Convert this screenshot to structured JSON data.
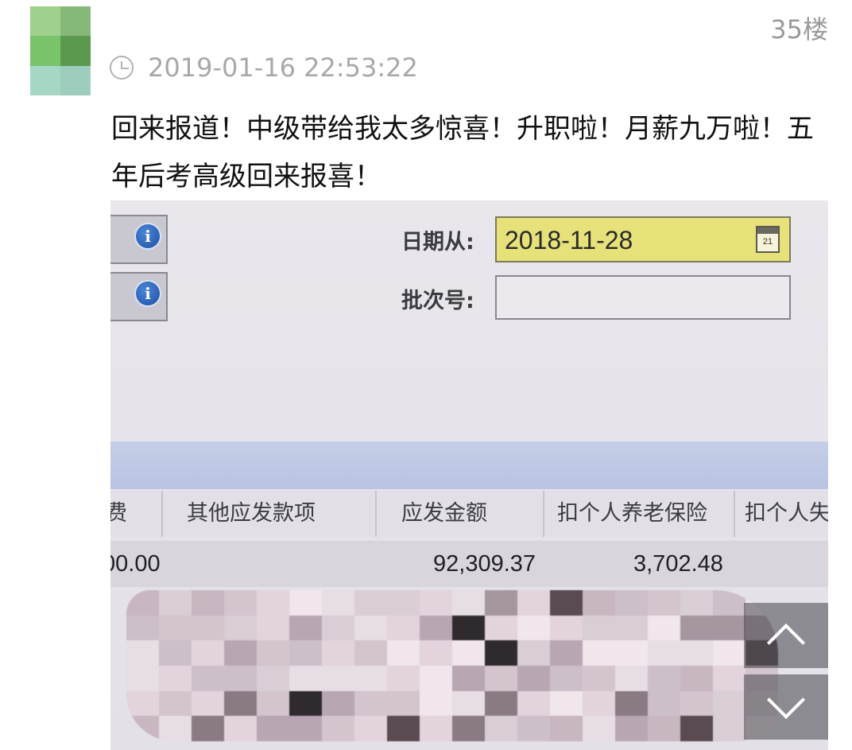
{
  "post": {
    "floor": "35楼",
    "timestamp": "2019-01-16 22:53:22",
    "text": "回来报道！中级带给我太多惊喜！升职啦！月薪九万啦！五年后考高级回来报喜！",
    "avatar_colors": [
      "#9fd08d",
      "#86b879",
      "#79c46a",
      "#5b9a4e",
      "#a6d6c4",
      "#9ecdbe"
    ]
  },
  "photo": {
    "date_from_label": "日期从:",
    "date_from_value": "2018-11-28",
    "calendar_day": "21",
    "batch_label": "批次号:",
    "batch_value": "",
    "table": {
      "headers": [
        "费",
        "其他应发款项",
        "应发金额",
        "扣个人养老保险",
        "扣个人失"
      ],
      "row": [
        "00.00",
        "",
        "92,309.37",
        "3,702.48",
        ""
      ]
    },
    "colors": {
      "date_field": "#e6e179",
      "band": "#bcc5e3",
      "info_icon": "#2d62b8"
    }
  }
}
